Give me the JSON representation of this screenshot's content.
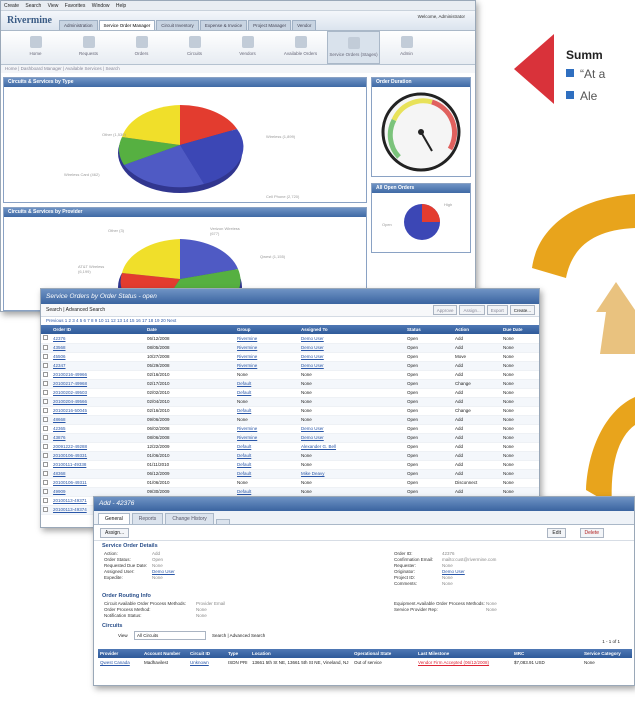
{
  "summary": {
    "title": "Summ",
    "bullets": [
      "“At a",
      "Ale"
    ]
  },
  "dashboard": {
    "menu": [
      "Create",
      "Search",
      "View",
      "Favorites",
      "Window",
      "Help"
    ],
    "logo": "Rivermine",
    "user_info": "Welcome, Administrator",
    "tabs": [
      "Administration",
      "Service Order Manager",
      "Circuit Inventory",
      "Expense & Invoice",
      "Project Manager",
      "Vendor"
    ],
    "active_tab": "Service Order Manager",
    "tools": [
      "Home",
      "Requests",
      "Orders",
      "Circuits",
      "Vendors",
      "Available Orders",
      "Service Orders (Stages)",
      "Admin"
    ],
    "subnav": "Home  |  Dashboard Manager  |  Available Services  |  Search",
    "panel_type_title": "Circuits & Services by Type",
    "panel_type_labels": [
      "Other (1,530)",
      "Wireless (1,899)",
      "Wireless Card (462)",
      "Cell Phone (2,720)"
    ],
    "panel_provider_title": "Circuits & Services by Provider",
    "panel_provider_labels": [
      "Other (3)",
      "Verizon Wireless (677)",
      "AT&T Wireless (6,199)",
      "Qwest (1,155)"
    ],
    "panel_duration_title": "Order Duration",
    "panel_open_title": "All Open Orders",
    "open_labels": [
      "Open",
      "High"
    ]
  },
  "orders": {
    "title": "Service Orders by Order Status - open",
    "search_tabs": "Search  |  Advanced Search",
    "buttons": [
      "Approve",
      "Assign...",
      "Export",
      "Create..."
    ],
    "pager": "Previous  1 2 3 4 5 6 7 8 9 10 11 12 13 14 15 16 17 18 19 20 Next",
    "columns": [
      "Order ID",
      "Date",
      "Group",
      "Assigned To",
      "Status",
      "Action",
      "Due Date"
    ],
    "rows": [
      [
        "42376",
        "06/12/2008",
        "Rivermine",
        "Demo User",
        "Open",
        "Add",
        "None"
      ],
      [
        "43568",
        "08/05/2008",
        "Rivermine",
        "Demo User",
        "Open",
        "Add",
        "None"
      ],
      [
        "45506",
        "10/27/2008",
        "Rivermine",
        "Demo User",
        "Open",
        "Move",
        "None"
      ],
      [
        "42347",
        "05/29/2008",
        "Rivermine",
        "Demo User",
        "Open",
        "Add",
        "None"
      ],
      [
        "20100216-49966",
        "02/16/2010",
        "None",
        "None",
        "Open",
        "Add",
        "None"
      ],
      [
        "20100217-49968",
        "02/17/2010",
        "Default",
        "None",
        "Open",
        "Change",
        "None"
      ],
      [
        "20100202-49503",
        "02/02/2010",
        "Default",
        "None",
        "Open",
        "Add",
        "None"
      ],
      [
        "20100204-49566",
        "02/04/2010",
        "None",
        "None",
        "Open",
        "Add",
        "None"
      ],
      [
        "20100216-50045",
        "02/16/2010",
        "Default",
        "None",
        "Open",
        "Change",
        "None"
      ],
      [
        "48668",
        "09/06/2009",
        "None",
        "None",
        "Open",
        "Add",
        "None"
      ],
      [
        "42365",
        "06/02/2008",
        "Rivermine",
        "Demo User",
        "Open",
        "Add",
        "None"
      ],
      [
        "43876",
        "08/06/2008",
        "Rivermine",
        "Demo User",
        "Open",
        "Add",
        "None"
      ],
      [
        "20091222-49288",
        "12/22/2009",
        "Default",
        "Alexander G. Bell",
        "Open",
        "Add",
        "None"
      ],
      [
        "20100106-49331",
        "01/06/2010",
        "Default",
        "None",
        "Open",
        "Add",
        "None"
      ],
      [
        "20100111-49338",
        "01/11/2010",
        "Default",
        "None",
        "Open",
        "Add",
        "None"
      ],
      [
        "48368",
        "06/12/2009",
        "Default",
        "Mike Deavy",
        "Open",
        "Add",
        "None"
      ],
      [
        "20100106-49311",
        "01/06/2010",
        "None",
        "None",
        "Open",
        "Disconnect",
        "None"
      ],
      [
        "49909",
        "09/30/2009",
        "Default",
        "None",
        "Open",
        "Add",
        "None"
      ],
      [
        "20100113-49371",
        "01/13/2010",
        "None",
        "None",
        "Open",
        "Add",
        "None"
      ],
      [
        "20100113-49374",
        "01/13/2010",
        "None",
        "None",
        "Open",
        "Add",
        "None"
      ]
    ]
  },
  "detail": {
    "title": "Add - 42376",
    "tabs": [
      "General",
      "Reports",
      "Change History",
      ""
    ],
    "assign_button": "Assign...",
    "edit_button": "Edit",
    "delete_button": "Delete",
    "section_details": "Service Order Details",
    "left_kv": [
      [
        "Action:",
        "Add"
      ],
      [
        "Order Status:",
        "Open"
      ],
      [
        "Requested Due Date:",
        "None"
      ],
      [
        "Assigned User:",
        "Demo User"
      ],
      [
        "Expedite:",
        "None"
      ]
    ],
    "right_kv": [
      [
        "Order ID:",
        "42376"
      ],
      [
        "Confirmation Email:",
        "mailto:cust@rivermine.com"
      ],
      [
        "Requester:",
        "None"
      ],
      [
        "Originator:",
        "Demo User"
      ],
      [
        "Project ID:",
        "None"
      ],
      [
        "Comments:",
        "None"
      ]
    ],
    "section_routing": "Order Routing Info",
    "routing_left": [
      [
        "Circuit Available Order Process Methods:",
        "Provider Email"
      ],
      [
        "Order Process Method:",
        "None"
      ],
      [
        "Notification Status:",
        "None"
      ]
    ],
    "routing_right": [
      [
        "Equipment Available Order Process Methods:",
        "None"
      ],
      [
        "Service Provider Rep:",
        "None"
      ]
    ],
    "section_circuits": "Circuits",
    "view_label": "View",
    "view_value": "All Circuits",
    "circuit_search": "Search  |  Advanced Search",
    "page_info": "1 - 1 of 1",
    "circuit_columns": [
      "Provider",
      "Account Number",
      "Circuit ID",
      "Type",
      "Location",
      "Operational State",
      "Last Milestone",
      "MRC",
      "Service Category"
    ],
    "circuit_row": [
      "Qwest Canada",
      "Madhavilest",
      "Unknown",
      "ISDN PRI",
      "13661 5th St NE, 13661 5th St NE, Vineland, NJ",
      "Out of service",
      "Vendor Firm Accepted (06/12/2008)",
      "$7,083.91 USD",
      "None"
    ]
  },
  "colors": {
    "accent": "#3f6aa5",
    "deco_red": "#d9323a",
    "deco_gold": "#e8a41c",
    "deco_tan": "#e9c27f",
    "bullet": "#2f6fc0"
  }
}
